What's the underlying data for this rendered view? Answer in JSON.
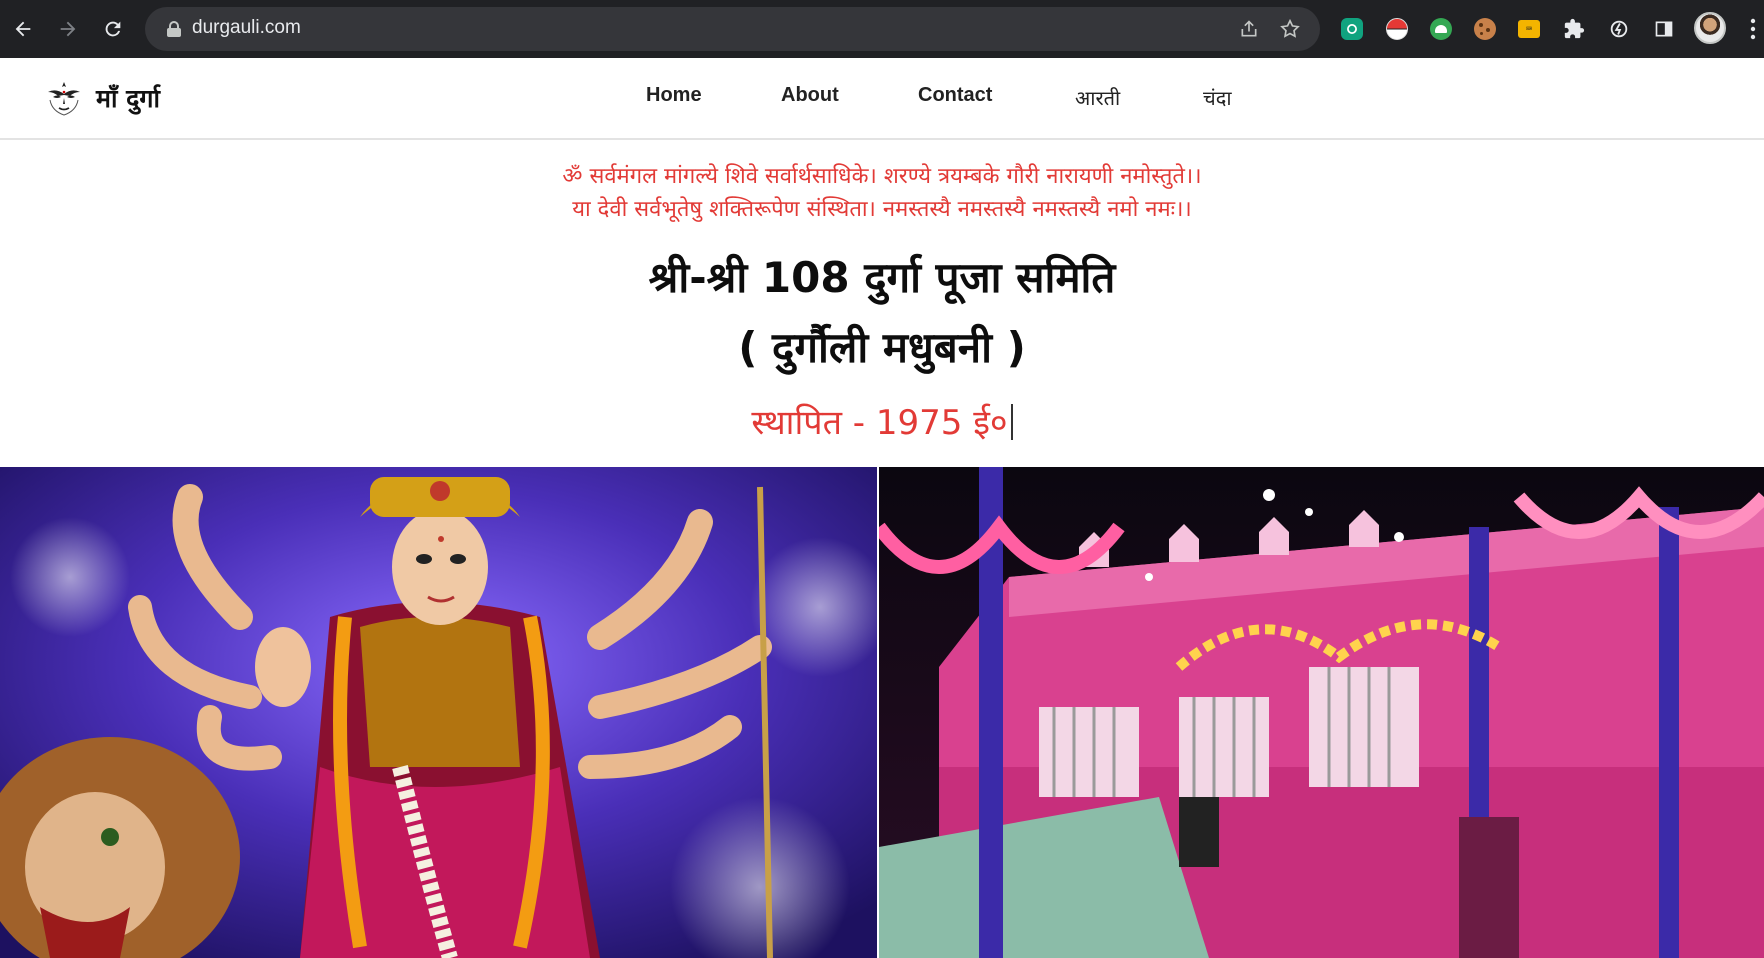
{
  "browser": {
    "url": "durgauli.com",
    "back_icon": "arrow-left-icon",
    "forward_icon": "arrow-right-icon",
    "reload_icon": "reload-icon",
    "share_icon": "share-icon",
    "bookmark_icon": "star-icon",
    "extensions": [
      "chatgpt-extension-icon",
      "pokeball-extension-icon",
      "android-extension-icon",
      "cookie-extension-icon",
      "keyboard-extension-icon",
      "puzzle-extensions-icon",
      "power-icon",
      "side-panel-icon"
    ],
    "menu_icon": "kebab-menu-icon"
  },
  "site": {
    "brand": "माँ दुर्गा",
    "nav": [
      "Home",
      "About",
      "Contact",
      "आरती",
      "चंदा"
    ]
  },
  "hero": {
    "mantra_line1": "ॐ सर्वमंगल मांगल्ये शिवे सर्वार्थसाधिके। शरण्ये त्रयम्बके गौरी नारायणी नमोस्तुते।।",
    "mantra_line2": "या देवी सर्वभूतेषु शक्तिरूपेण संस्थिता। नमस्तस्यै नमस्तस्यै नमस्तस्यै नमो नमः।।",
    "title_line1": "श्री-श्री 108 दुर्गा पूजा समिति",
    "title_line2": "( दुर्गौली मधुबनी )",
    "established": "स्थापित - 1975 ई०"
  },
  "images": {
    "left": "durga-idol-image",
    "right": "temple-building-image"
  },
  "colors": {
    "accent_red": "#e23a36",
    "chrome_bg": "#202124",
    "omnibox_bg": "#35363a"
  }
}
